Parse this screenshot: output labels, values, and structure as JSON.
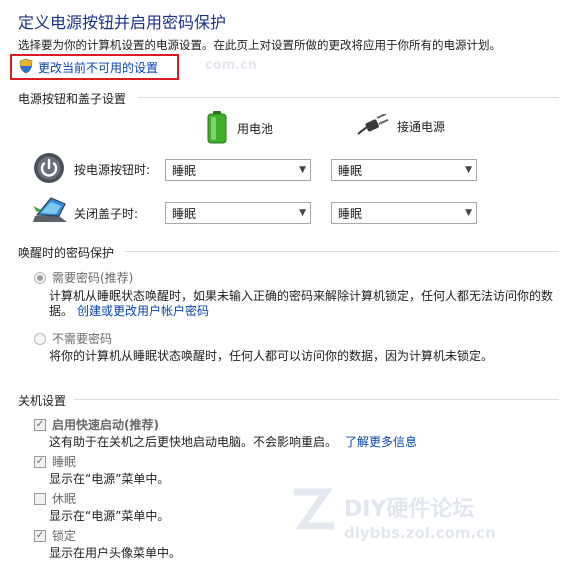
{
  "header": {
    "title": "定义电源按钮并启用密码保护",
    "description": "选择要为你的计算机设置的电源设置。在此页上对设置所做的更改将应用于你所有的电源计划。",
    "change_link": "更改当前不可用的设置"
  },
  "power_section": {
    "title": "电源按钮和盖子设置",
    "col_battery": "用电池",
    "col_plugged": "接通电源",
    "rows": [
      {
        "label": "按电源按钮时:",
        "battery": "睡眠",
        "plugged": "睡眠"
      },
      {
        "label": "关闭盖子时:",
        "battery": "睡眠",
        "plugged": "睡眠"
      }
    ]
  },
  "password_section": {
    "title": "唤醒时的密码保护",
    "require": {
      "label": "需要密码(推荐)",
      "desc1": "计算机从睡眠状态唤醒时，如果未输入正确的密码来解除计算机锁定，任何人都无法访问你的数",
      "desc2": "据。",
      "link": "创建或更改用户帐户密码"
    },
    "norequire": {
      "label": "不需要密码",
      "desc": "将你的计算机从睡眠状态唤醒时，任何人都可以访问你的数据，因为计算机未锁定。"
    }
  },
  "shutdown_section": {
    "title": "关机设置",
    "fast_startup": {
      "label": "启用快速启动(推荐)",
      "desc": "这有助于在关机之后更快地启动电脑。不会影响重启。",
      "link": "了解更多信息",
      "checked": true
    },
    "sleep": {
      "label": "睡眠",
      "desc": "显示在“电源”菜单中。",
      "checked": true
    },
    "hibernate": {
      "label": "休眠",
      "desc": "显示在“电源”菜单中。",
      "checked": false
    },
    "lock": {
      "label": "锁定",
      "desc": "显示在用户头像菜单中。",
      "checked": true
    }
  },
  "watermarks": {
    "top": "com.cn",
    "brand": "DIY硬件论坛",
    "url": "diybbs.zol.com.cn"
  },
  "icons": {
    "shield": "uac-shield-icon",
    "battery": "battery-icon",
    "plug": "power-plug-icon",
    "power_button": "power-button-icon",
    "laptop_lid": "laptop-lid-icon"
  },
  "colors": {
    "title": "#1e3287",
    "link": "#0a44b0",
    "highlight_border": "#d81e1e",
    "battery_green": "#3fae2a"
  }
}
